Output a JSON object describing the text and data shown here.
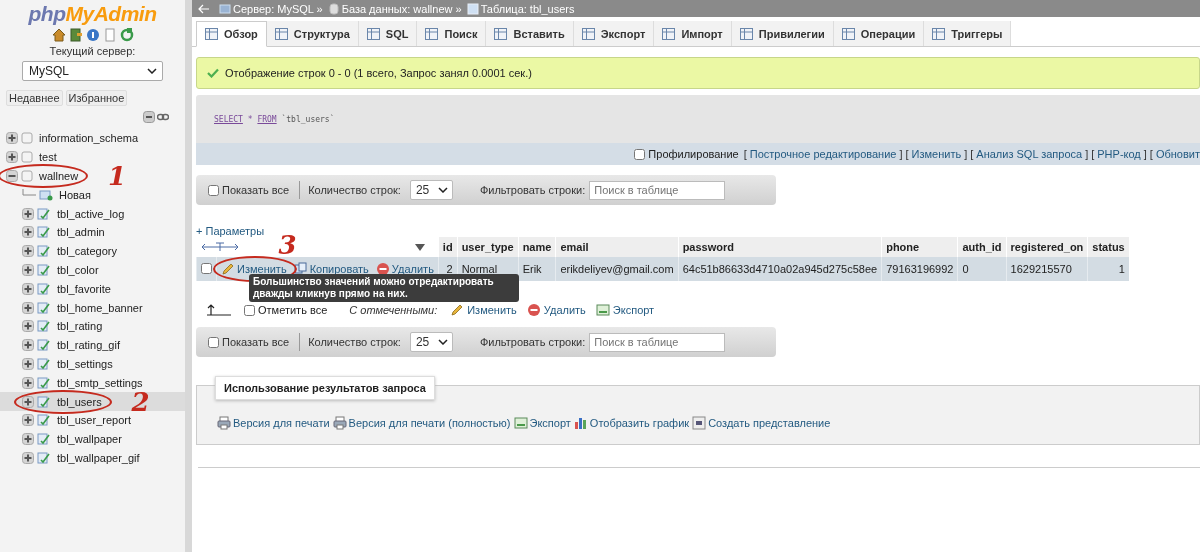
{
  "sidebar": {
    "logo": {
      "part1": "php",
      "part2": "MyAdmin"
    },
    "server_label": "Текущий сервер:",
    "server_select": "MySQL",
    "buttons": [
      "Недавнее",
      "Избранное"
    ],
    "databases": [
      {
        "label": "information_schema",
        "kind": "database",
        "expanded": false,
        "selected": false
      },
      {
        "label": "test",
        "kind": "database",
        "expanded": false,
        "selected": false
      },
      {
        "label": "wallnew",
        "kind": "database",
        "expanded": true,
        "selected": false,
        "annotation": "1",
        "children": [
          {
            "label": "Новая",
            "kind": "new",
            "selected": false
          },
          {
            "label": "tbl_active_log",
            "kind": "table",
            "expanded": false,
            "selected": false
          },
          {
            "label": "tbl_admin",
            "kind": "table",
            "expanded": false,
            "selected": false
          },
          {
            "label": "tbl_category",
            "kind": "table",
            "expanded": false,
            "selected": false
          },
          {
            "label": "tbl_color",
            "kind": "table",
            "expanded": false,
            "selected": false
          },
          {
            "label": "tbl_favorite",
            "kind": "table",
            "expanded": false,
            "selected": false
          },
          {
            "label": "tbl_home_banner",
            "kind": "table",
            "expanded": false,
            "selected": false
          },
          {
            "label": "tbl_rating",
            "kind": "table",
            "expanded": false,
            "selected": false
          },
          {
            "label": "tbl_rating_gif",
            "kind": "table",
            "expanded": false,
            "selected": false
          },
          {
            "label": "tbl_settings",
            "kind": "table",
            "expanded": false,
            "selected": false
          },
          {
            "label": "tbl_smtp_settings",
            "kind": "table",
            "expanded": false,
            "selected": false
          },
          {
            "label": "tbl_users",
            "kind": "table",
            "expanded": false,
            "selected": true,
            "annotation": "2"
          },
          {
            "label": "tbl_user_report",
            "kind": "table",
            "expanded": false,
            "selected": false
          },
          {
            "label": "tbl_wallpaper",
            "kind": "table",
            "expanded": false,
            "selected": false
          },
          {
            "label": "tbl_wallpaper_gif",
            "kind": "table",
            "expanded": false,
            "selected": false
          }
        ]
      }
    ]
  },
  "breadcrumbs": [
    "Сервер: MySQL »",
    "База данных: wallnew »",
    "Таблица: tbl_users"
  ],
  "tabs": [
    {
      "label": "Обзор",
      "selected": true
    },
    {
      "label": "Структура",
      "selected": false
    },
    {
      "label": "SQL",
      "selected": false
    },
    {
      "label": "Поиск",
      "selected": false
    },
    {
      "label": "Вставить",
      "selected": false
    },
    {
      "label": "Экспорт",
      "selected": false
    },
    {
      "label": "Импорт",
      "selected": false
    },
    {
      "label": "Привилегии",
      "selected": false
    },
    {
      "label": "Операции",
      "selected": false
    },
    {
      "label": "Триггеры",
      "selected": false
    }
  ],
  "message": "Отображение строк 0 - 0 (1 всего, Запрос занял 0.0001 сек.)",
  "query": {
    "keywords": [
      "SELECT",
      "*",
      "FROM"
    ],
    "table": "`tbl_users`"
  },
  "query_tools": {
    "profiling": {
      "label": "Профилирование",
      "checked": false
    },
    "segments": [
      {
        "kind": "bracket",
        "text": "["
      },
      {
        "kind": "link",
        "text": "Построчное редактирование"
      },
      {
        "kind": "bracket",
        "text": "]"
      },
      {
        "kind": "bracket",
        "text": "["
      },
      {
        "kind": "link",
        "text": "Изменить"
      },
      {
        "kind": "bracket",
        "text": "]"
      },
      {
        "kind": "bracket",
        "text": "["
      },
      {
        "kind": "link",
        "text": "Анализ SQL запроса"
      },
      {
        "kind": "bracket",
        "text": "]"
      },
      {
        "kind": "bracket",
        "text": "["
      },
      {
        "kind": "link",
        "text": "PHP-код"
      },
      {
        "kind": "bracket",
        "text": "]"
      },
      {
        "kind": "bracket",
        "text": "["
      },
      {
        "kind": "link",
        "text": "Обновит"
      }
    ]
  },
  "navbars": [
    {
      "show_all": {
        "label": "Показать все",
        "checked": false
      },
      "rows_label": "Количество строк:",
      "rows_value": "25",
      "filter_label": "Фильтровать строки:",
      "filter_placeholder": "Поиск в таблице"
    },
    {
      "show_all": {
        "label": "Показать все",
        "checked": false
      },
      "rows_label": "Количество строк:",
      "rows_value": "25",
      "filter_label": "Фильтровать строки:",
      "filter_placeholder": "Поиск в таблице"
    }
  ],
  "options_link": "+ Параметры",
  "table": {
    "columns": [
      "id",
      "user_type",
      "name",
      "email",
      "password",
      "phone",
      "auth_id",
      "registered_on",
      "status"
    ],
    "rows": [
      {
        "checked": false,
        "actions": [
          {
            "kind": "edit",
            "label": "Изменить",
            "annotation": "3"
          },
          {
            "kind": "copy",
            "label": "Копировать"
          },
          {
            "kind": "delete",
            "label": "Удалить"
          }
        ],
        "cells": [
          "2",
          "Normal",
          "Erik",
          "erikdeliyev@gmail.com",
          "64c51b86633d4710a02a945d275c58ee",
          "79163196992",
          "0",
          "1629215570",
          "1"
        ]
      }
    ],
    "tooltip": "Большинство значений можно отредактировать дважды кликнув прямо на них."
  },
  "bulk": {
    "check_all": {
      "label": "Отметить все",
      "checked": false
    },
    "with_selected": "С отмеченными:",
    "actions": [
      {
        "kind": "edit",
        "label": "Изменить"
      },
      {
        "kind": "delete",
        "label": "Удалить"
      },
      {
        "kind": "export",
        "label": "Экспорт"
      }
    ]
  },
  "query_results": {
    "title": "Использование результатов запроса",
    "links": [
      {
        "kind": "print",
        "label": "Версия для печати"
      },
      {
        "kind": "print",
        "label": "Версия для печати (полностью)"
      },
      {
        "kind": "export",
        "label": "Экспорт"
      },
      {
        "kind": "chart",
        "label": "Отобразить график"
      },
      {
        "kind": "view",
        "label": "Создать представление"
      }
    ]
  }
}
